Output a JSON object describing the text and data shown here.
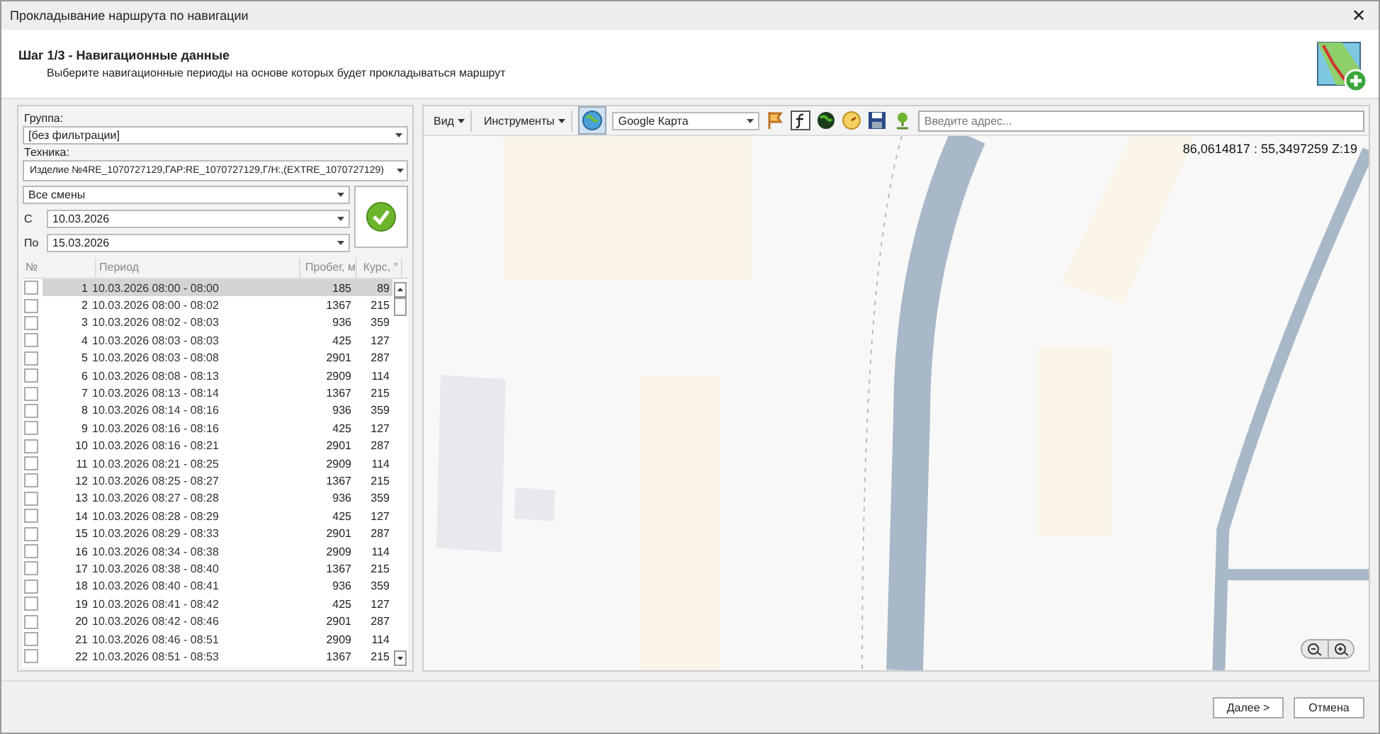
{
  "window": {
    "title": "Прокладывание наршрута по навигации",
    "close": "✕"
  },
  "header": {
    "title": "Шаг 1/3 - Навигационные данные",
    "subtitle": "Выберите навигационные периоды на основе которых будет прокладываться маршрут"
  },
  "filters": {
    "group_label": "Группа:",
    "group_value": "[без фильтрации]",
    "vehicle_label": "Техника:",
    "vehicle_value": "Изделие №4RE_1070727129,ГАР:RE_1070727129,Г/Н:,(EXTRE_1070727129)",
    "shift_value": "Все смены",
    "from_label": "С",
    "from_value": "10.03.2026",
    "to_label": "По",
    "to_value": "15.03.2026"
  },
  "table": {
    "columns": [
      "№",
      "Период",
      "Пробег, м",
      "Курс, °"
    ],
    "rows": [
      {
        "checked": false,
        "selected": true,
        "num": "1",
        "period": "10.03.2026 08:00 - 08:00",
        "distance": "185",
        "course": "89"
      },
      {
        "checked": false,
        "selected": false,
        "num": "2",
        "period": "10.03.2026 08:00 - 08:02",
        "distance": "1367",
        "course": "215"
      },
      {
        "checked": false,
        "selected": false,
        "num": "3",
        "period": "10.03.2026 08:02 - 08:03",
        "distance": "936",
        "course": "359"
      },
      {
        "checked": false,
        "selected": false,
        "num": "4",
        "period": "10.03.2026 08:03 - 08:03",
        "distance": "425",
        "course": "127"
      },
      {
        "checked": false,
        "selected": false,
        "num": "5",
        "period": "10.03.2026 08:03 - 08:08",
        "distance": "2901",
        "course": "287"
      },
      {
        "checked": false,
        "selected": false,
        "num": "6",
        "period": "10.03.2026 08:08 - 08:13",
        "distance": "2909",
        "course": "114"
      },
      {
        "checked": false,
        "selected": false,
        "num": "7",
        "period": "10.03.2026 08:13 - 08:14",
        "distance": "1367",
        "course": "215"
      },
      {
        "checked": false,
        "selected": false,
        "num": "8",
        "period": "10.03.2026 08:14 - 08:16",
        "distance": "936",
        "course": "359"
      },
      {
        "checked": false,
        "selected": false,
        "num": "9",
        "period": "10.03.2026 08:16 - 08:16",
        "distance": "425",
        "course": "127"
      },
      {
        "checked": false,
        "selected": false,
        "num": "10",
        "period": "10.03.2026 08:16 - 08:21",
        "distance": "2901",
        "course": "287"
      },
      {
        "checked": false,
        "selected": false,
        "num": "11",
        "period": "10.03.2026 08:21 - 08:25",
        "distance": "2909",
        "course": "114"
      },
      {
        "checked": false,
        "selected": false,
        "num": "12",
        "period": "10.03.2026 08:25 - 08:27",
        "distance": "1367",
        "course": "215"
      },
      {
        "checked": false,
        "selected": false,
        "num": "13",
        "period": "10.03.2026 08:27 - 08:28",
        "distance": "936",
        "course": "359"
      },
      {
        "checked": false,
        "selected": false,
        "num": "14",
        "period": "10.03.2026 08:28 - 08:29",
        "distance": "425",
        "course": "127"
      },
      {
        "checked": false,
        "selected": false,
        "num": "15",
        "period": "10.03.2026 08:29 - 08:33",
        "distance": "2901",
        "course": "287"
      },
      {
        "checked": false,
        "selected": false,
        "num": "16",
        "period": "10.03.2026 08:34 - 08:38",
        "distance": "2909",
        "course": "114"
      },
      {
        "checked": false,
        "selected": false,
        "num": "17",
        "period": "10.03.2026 08:38 - 08:40",
        "distance": "1367",
        "course": "215"
      },
      {
        "checked": false,
        "selected": false,
        "num": "18",
        "period": "10.03.2026 08:40 - 08:41",
        "distance": "936",
        "course": "359"
      },
      {
        "checked": false,
        "selected": false,
        "num": "19",
        "period": "10.03.2026 08:41 - 08:42",
        "distance": "425",
        "course": "127"
      },
      {
        "checked": false,
        "selected": false,
        "num": "20",
        "period": "10.03.2026 08:42 - 08:46",
        "distance": "2901",
        "course": "287"
      },
      {
        "checked": false,
        "selected": false,
        "num": "21",
        "period": "10.03.2026 08:46 - 08:51",
        "distance": "2909",
        "course": "114"
      },
      {
        "checked": false,
        "selected": false,
        "num": "22",
        "period": "10.03.2026 08:51 - 08:53",
        "distance": "1367",
        "course": "215"
      }
    ]
  },
  "map": {
    "menus": [
      "Вид",
      "Инструменты"
    ],
    "provider": "Google Карта",
    "address_placeholder": "Введите адрес...",
    "coordinates": "86,0614817 : 55,3497259 Z:19"
  },
  "buttons": [
    "Далее >",
    "Отмена"
  ]
}
